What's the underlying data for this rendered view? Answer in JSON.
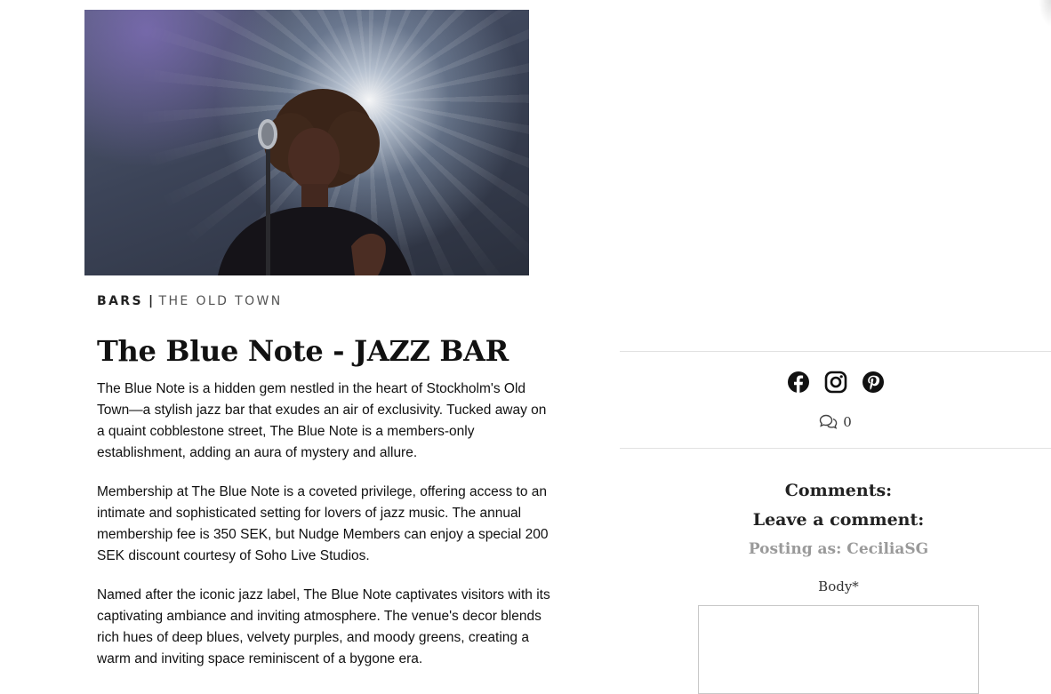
{
  "hero": {
    "alt": "Jazz singer performing at a vintage microphone under stage lights"
  },
  "article": {
    "category": "BARS",
    "separator": "|",
    "area": "THE OLD TOWN",
    "title": "The Blue Note - JAZZ BAR",
    "paragraphs": [
      "The Blue Note is a hidden gem nestled in the heart of Stockholm's Old Town—a stylish jazz bar that exudes an air of exclusivity. Tucked away on a quaint cobblestone street, The Blue Note is a members-only establishment, adding an aura of mystery and allure.",
      "Membership at The Blue Note is a coveted privilege, offering access to an intimate and sophisticated setting for lovers of jazz music. The annual membership fee is 350 SEK, but Nudge Members can enjoy a special 200 SEK discount courtesy of Soho Live Studios.",
      "Named after the iconic jazz label, The Blue Note captivates visitors with its captivating ambiance and inviting atmosphere. The venue's decor blends rich hues of deep blues, velvety purples, and moody greens, creating a warm and inviting space reminiscent of a bygone era."
    ]
  },
  "share": {
    "icons": [
      "facebook-icon",
      "instagram-icon",
      "pinterest-icon"
    ],
    "comment_count": "0"
  },
  "comments": {
    "heading": "Comments:",
    "leave": "Leave a comment:",
    "posting_as": "Posting as: CeciliaSG",
    "body_label": "Body*",
    "body_value": ""
  },
  "colors": {
    "text": "#111111",
    "muted": "#9a9a9a",
    "divider": "#e2e2e2"
  }
}
